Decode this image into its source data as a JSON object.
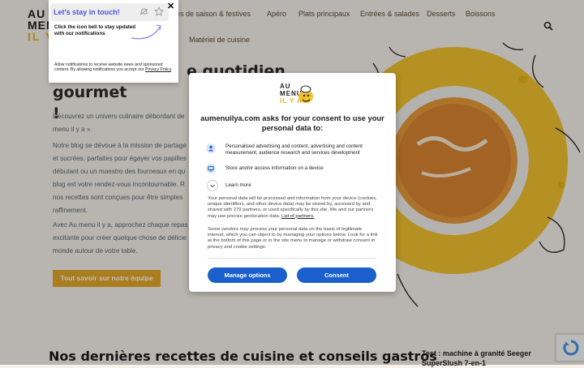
{
  "site": {
    "logo": {
      "line1": "AU",
      "line2": "MENU",
      "line3": "IL Y A"
    },
    "nav": [
      "ttes de saison & festives",
      "Apéro",
      "Plats principaux",
      "Entrées & salades",
      "Desserts",
      "Boissons",
      "Matériel de cuisine"
    ],
    "hero_title_line1": "e quotidien",
    "hero_title_line2": "gourmet !",
    "paragraphs": [
      [
        "Découvrez un univers culinaire débordant de",
        "menu il y a »."
      ],
      [
        "Notre blog se dévoue à la mission de partage",
        "et sucrées, parfaites pour égayer vos papilles",
        "débutant ou un maestro des fourneaux en qu",
        "blog est votre rendez-vous incontournable. R",
        "nos recettes sont conçues pour être simples",
        "raffinement."
      ],
      [
        "Avec Au menu il y a, approchez chaque repas",
        "excitante pour créer quelque chose de délicie",
        "monde autour de votre table."
      ]
    ],
    "cta": "Tout savoir sur notre équipe",
    "bottom_title": "Nos dernières recettes de cuisine et conseils gastros",
    "side_post": [
      "Test : machine à granité Seeger",
      "SuperSlush 7-en-1"
    ]
  },
  "notification": {
    "title": "Let's stay in touch!",
    "subtitle": "Click the icon bell to stay updated with our notifications",
    "footer": "Allow notifications to receive website news and sponsored content. By allowing notifications you accept our",
    "privacy_link": "Privacy Policy",
    "close": "✕"
  },
  "consent": {
    "logo": {
      "line1": "AU",
      "line2": "MENU",
      "line3": "IL Y A"
    },
    "title": "aumenuilya.com asks for your consent to use your personal data to:",
    "purposes": [
      "Personalised advertising and content, advertising and content measurement, audience research and services development",
      "Store and/or access information on a device"
    ],
    "learn_more": "Learn more",
    "body1": "Your personal data will be processed and information from your device (cookies, unique identifiers, and other device data) may be stored by, accessed by and shared with 279 partners, or used specifically by this site. We and our partners may use precise geolocation data.",
    "partners_link": "List of partners.",
    "body2": "Some vendors may process your personal data on the basis of legitimate interest, which you can object to by managing your options below. Look for a link at the bottom of this page or in the site menu to manage or withdraw consent in privacy and cookie settings.",
    "manage_button": "Manage options",
    "consent_button": "Consent"
  },
  "colors": {
    "accent": "#e3a72a",
    "consent_blue": "#1a5fcc",
    "notif_title": "#4a55d6"
  },
  "icons": [
    "bell-icon",
    "star-icon",
    "search-icon",
    "person-icon",
    "device-icon",
    "chevron-down-icon",
    "close-icon",
    "recaptcha-icon"
  ]
}
